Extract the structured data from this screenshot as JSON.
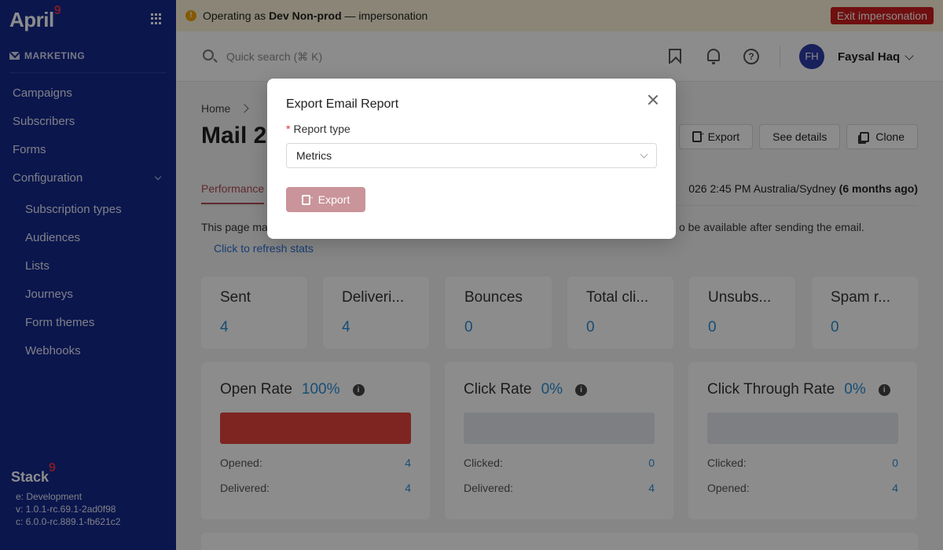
{
  "sidebar": {
    "logo": "April",
    "logo_mark": "9",
    "section": "MARKETING",
    "items": [
      {
        "label": "Campaigns"
      },
      {
        "label": "Subscribers"
      },
      {
        "label": "Forms"
      },
      {
        "label": "Configuration"
      }
    ],
    "sub_items": [
      {
        "label": "Subscription types"
      },
      {
        "label": "Audiences"
      },
      {
        "label": "Lists"
      },
      {
        "label": "Journeys"
      },
      {
        "label": "Form themes"
      },
      {
        "label": "Webhooks"
      }
    ],
    "stack_logo": "Stack",
    "stack_mark": "9",
    "env_e": "e: Development",
    "env_v": "v: 1.0.1-rc.69.1-2ad0f98",
    "env_c": "c: 6.0.0-rc.889.1-fb621c2"
  },
  "banner": {
    "prefix": "Operating as",
    "env_name": "Dev Non-prod",
    "suffix": "— impersonation",
    "exit_label": "Exit impersonation"
  },
  "topbar": {
    "search_placeholder": "Quick search (⌘ K)",
    "avatar_initials": "FH",
    "user_name": "Faysal Haq"
  },
  "page": {
    "breadcrumb_home": "Home",
    "title": "Mail 2",
    "export_label": "Export",
    "details_label": "See details",
    "clone_label": "Clone",
    "tab_performance": "Performance",
    "sent_info": "026 2:45 PM Australia/Sydney",
    "sent_ago": "(6 months ago)",
    "notice_left": "This page ma",
    "notice_right": "o be available after sending the email.",
    "refresh_link": "Click to refresh stats"
  },
  "stats": [
    {
      "label": "Sent",
      "value": "4"
    },
    {
      "label": "Deliveri...",
      "value": "4"
    },
    {
      "label": "Bounces",
      "value": "0"
    },
    {
      "label": "Total cli...",
      "value": "0"
    },
    {
      "label": "Unsubs...",
      "value": "0"
    },
    {
      "label": "Spam r...",
      "value": "0"
    }
  ],
  "rates": [
    {
      "title": "Open Rate",
      "value": "100%",
      "fill": 1.0,
      "row1_label": "Opened:",
      "row1_value": "4",
      "row2_label": "Delivered:",
      "row2_value": "4"
    },
    {
      "title": "Click Rate",
      "value": "0%",
      "fill": 0.0,
      "row1_label": "Clicked:",
      "row1_value": "0",
      "row2_label": "Delivered:",
      "row2_value": "4"
    },
    {
      "title": "Click Through Rate",
      "value": "0%",
      "fill": 0.0,
      "row1_label": "Clicked:",
      "row1_value": "0",
      "row2_label": "Opened:",
      "row2_value": "4"
    }
  ],
  "modal": {
    "title": "Export Email Report",
    "required_mark": "*",
    "field_label": "Report type",
    "select_value": "Metrics",
    "export_label": "Export"
  }
}
